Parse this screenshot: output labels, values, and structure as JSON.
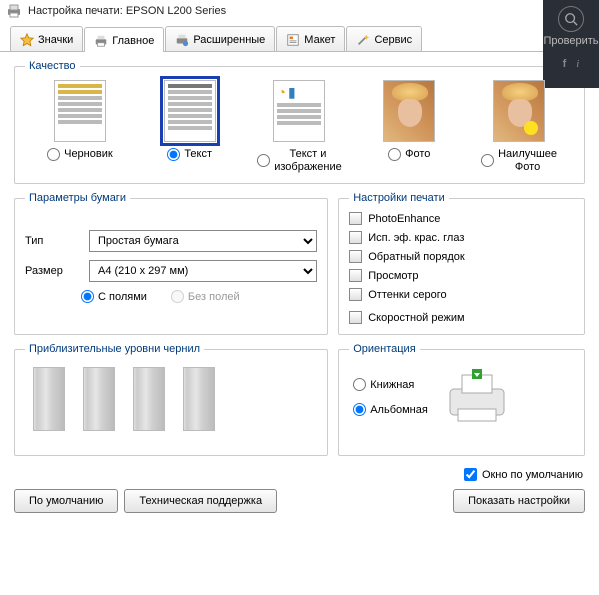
{
  "window": {
    "title": "Настройка печати: EPSON L200 Series"
  },
  "overlay": {
    "label": "Проверить",
    "icons": [
      "f",
      "i"
    ]
  },
  "tabs": [
    {
      "label": "Значки"
    },
    {
      "label": "Главное",
      "active": true
    },
    {
      "label": "Расширенные"
    },
    {
      "label": "Макет"
    },
    {
      "label": "Сервис"
    }
  ],
  "quality": {
    "legend": "Качество",
    "options": [
      {
        "key": "draft",
        "label": "Черновик"
      },
      {
        "key": "text",
        "label": "Текст",
        "selected": true
      },
      {
        "key": "text_img",
        "label": "Текст и\nизображение"
      },
      {
        "key": "photo",
        "label": "Фото"
      },
      {
        "key": "best_photo",
        "label": "Наилучшее\nФото"
      }
    ]
  },
  "paper": {
    "legend": "Параметры бумаги",
    "type_label": "Тип",
    "type_value": "Простая бумага",
    "size_label": "Размер",
    "size_value": "A4 (210 x 297 мм)",
    "with_margins": "С полями",
    "without_margins": "Без полей"
  },
  "print_settings": {
    "legend": "Настройки печати",
    "items": [
      "PhotoEnhance",
      "Исп. эф. крас. глаз",
      "Обратный порядок",
      "Просмотр",
      "Оттенки серого"
    ],
    "speed": "Скоростной режим"
  },
  "ink": {
    "legend": "Приблизительные уровни чернил"
  },
  "orientation": {
    "legend": "Ориентация",
    "portrait": "Книжная",
    "landscape": "Альбомная"
  },
  "footer": {
    "default_window": "Окно по умолчанию",
    "btn_defaults": "По умолчанию",
    "btn_support": "Техническая поддержка",
    "btn_show": "Показать настройки"
  }
}
